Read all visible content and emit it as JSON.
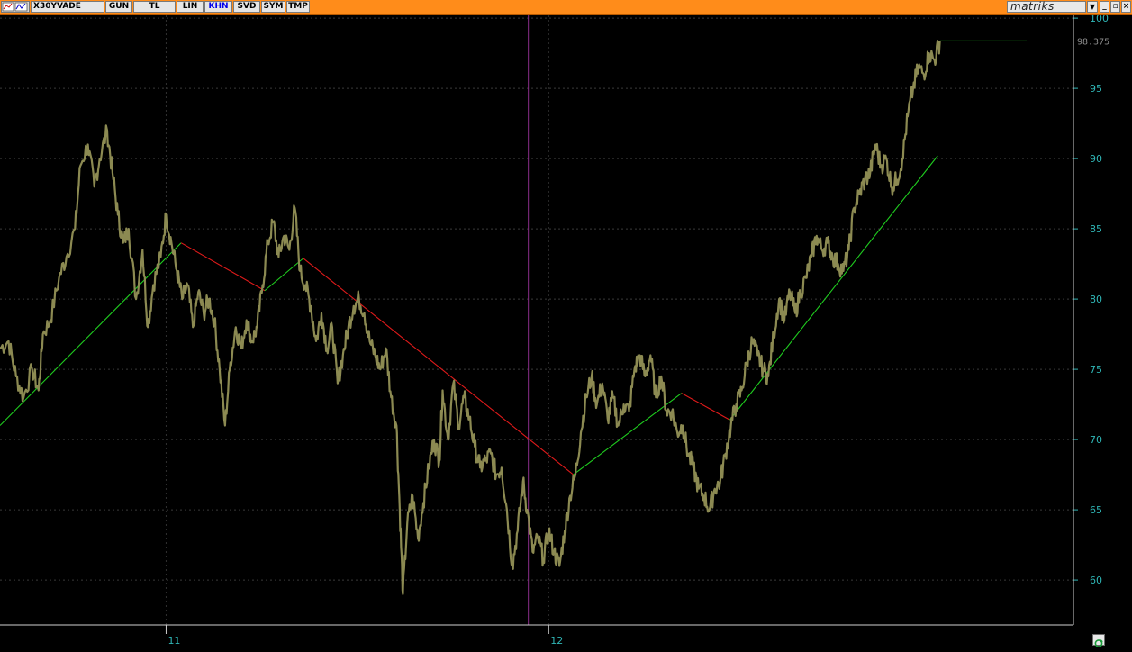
{
  "toolbar": {
    "symbol": "X30YVADE",
    "buttons": [
      "GUN",
      "TL",
      "LIN",
      "KHN",
      "SVD",
      "SYM",
      "TMP"
    ],
    "active_button": "KHN",
    "brand": "matriks",
    "window_controls": [
      "_",
      "restore",
      "x"
    ]
  },
  "colors": {
    "toolbar": "#ff8c1a",
    "price_series": "#8c8a52",
    "uptrend": "#1fcc1f",
    "downtrend": "#e01a1a",
    "axis_text": "#2fb5b5",
    "cursor_line": "#8a2e8a",
    "background": "#000000"
  },
  "chart_data": {
    "type": "line",
    "symbol": "X30YVADE",
    "y_ticks": [
      60,
      65,
      70,
      75,
      80,
      85,
      90,
      95,
      100
    ],
    "ylim": [
      56.8,
      100.2
    ],
    "last_price_label": "98.375",
    "last_price": 98.375,
    "x_tick_labels": [
      {
        "label": "11",
        "t": 0.155
      },
      {
        "label": "12",
        "t": 0.512
      }
    ],
    "cursor_t": 0.493,
    "price_series": [
      [
        0.0,
        76.5
      ],
      [
        0.008,
        77.0
      ],
      [
        0.015,
        74.5
      ],
      [
        0.022,
        73.0
      ],
      [
        0.03,
        75.0
      ],
      [
        0.036,
        73.5
      ],
      [
        0.04,
        77.5
      ],
      [
        0.047,
        78.5
      ],
      [
        0.055,
        81.5
      ],
      [
        0.062,
        83.0
      ],
      [
        0.07,
        85.0
      ],
      [
        0.075,
        89.5
      ],
      [
        0.082,
        91.0
      ],
      [
        0.088,
        88.0
      ],
      [
        0.093,
        90.0
      ],
      [
        0.1,
        92.0
      ],
      [
        0.105,
        89.0
      ],
      [
        0.11,
        86.0
      ],
      [
        0.115,
        84.0
      ],
      [
        0.12,
        85.0
      ],
      [
        0.127,
        80.0
      ],
      [
        0.133,
        83.5
      ],
      [
        0.138,
        78.0
      ],
      [
        0.143,
        81.0
      ],
      [
        0.15,
        83.0
      ],
      [
        0.155,
        86.0
      ],
      [
        0.16,
        84.0
      ],
      [
        0.165,
        82.0
      ],
      [
        0.17,
        80.0
      ],
      [
        0.175,
        81.0
      ],
      [
        0.18,
        78.0
      ],
      [
        0.185,
        80.5
      ],
      [
        0.19,
        79.0
      ],
      [
        0.195,
        80.0
      ],
      [
        0.2,
        78.5
      ],
      [
        0.205,
        75.0
      ],
      [
        0.21,
        71.0
      ],
      [
        0.215,
        75.5
      ],
      [
        0.22,
        78.0
      ],
      [
        0.225,
        76.5
      ],
      [
        0.23,
        78.5
      ],
      [
        0.235,
        77.0
      ],
      [
        0.24,
        78.0
      ],
      [
        0.245,
        81.0
      ],
      [
        0.25,
        84.0
      ],
      [
        0.255,
        85.5
      ],
      [
        0.26,
        83.0
      ],
      [
        0.265,
        84.5
      ],
      [
        0.27,
        83.5
      ],
      [
        0.275,
        86.5
      ],
      [
        0.28,
        82.0
      ],
      [
        0.285,
        81.0
      ],
      [
        0.29,
        79.5
      ],
      [
        0.295,
        77.0
      ],
      [
        0.3,
        79.0
      ],
      [
        0.305,
        76.5
      ],
      [
        0.31,
        78.0
      ],
      [
        0.315,
        74.0
      ],
      [
        0.32,
        76.0
      ],
      [
        0.325,
        78.0
      ],
      [
        0.33,
        79.5
      ],
      [
        0.335,
        80.0
      ],
      [
        0.34,
        79.0
      ],
      [
        0.345,
        77.0
      ],
      [
        0.35,
        76.0
      ],
      [
        0.355,
        75.0
      ],
      [
        0.36,
        76.5
      ],
      [
        0.365,
        73.0
      ],
      [
        0.37,
        71.0
      ],
      [
        0.373,
        65.0
      ],
      [
        0.376,
        59.0
      ],
      [
        0.38,
        64.0
      ],
      [
        0.385,
        66.0
      ],
      [
        0.39,
        63.0
      ],
      [
        0.395,
        65.5
      ],
      [
        0.4,
        68.0
      ],
      [
        0.405,
        70.0
      ],
      [
        0.41,
        68.5
      ],
      [
        0.413,
        73.5
      ],
      [
        0.418,
        70.0
      ],
      [
        0.423,
        74.0
      ],
      [
        0.428,
        71.0
      ],
      [
        0.433,
        73.0
      ],
      [
        0.438,
        71.5
      ],
      [
        0.443,
        69.5
      ],
      [
        0.448,
        68.0
      ],
      [
        0.453,
        68.5
      ],
      [
        0.458,
        69.0
      ],
      [
        0.463,
        67.5
      ],
      [
        0.468,
        68.0
      ],
      [
        0.473,
        65.0
      ],
      [
        0.478,
        61.0
      ],
      [
        0.483,
        63.5
      ],
      [
        0.488,
        67.0
      ],
      [
        0.492,
        65.0
      ],
      [
        0.497,
        62.0
      ],
      [
        0.502,
        63.0
      ],
      [
        0.507,
        61.5
      ],
      [
        0.512,
        63.5
      ],
      [
        0.517,
        62.0
      ],
      [
        0.522,
        61.0
      ],
      [
        0.527,
        63.5
      ],
      [
        0.532,
        66.0
      ],
      [
        0.537,
        67.5
      ],
      [
        0.542,
        70.5
      ],
      [
        0.547,
        73.0
      ],
      [
        0.552,
        74.5
      ],
      [
        0.557,
        72.5
      ],
      [
        0.562,
        74.0
      ],
      [
        0.567,
        71.5
      ],
      [
        0.572,
        73.0
      ],
      [
        0.577,
        71.0
      ],
      [
        0.582,
        72.5
      ],
      [
        0.587,
        72.0
      ],
      [
        0.592,
        75.0
      ],
      [
        0.597,
        76.0
      ],
      [
        0.602,
        74.5
      ],
      [
        0.607,
        76.0
      ],
      [
        0.612,
        73.0
      ],
      [
        0.617,
        74.5
      ],
      [
        0.622,
        72.0
      ],
      [
        0.627,
        72.0
      ],
      [
        0.632,
        70.5
      ],
      [
        0.637,
        71.0
      ],
      [
        0.642,
        69.0
      ],
      [
        0.647,
        68.0
      ],
      [
        0.652,
        66.5
      ],
      [
        0.657,
        66.0
      ],
      [
        0.662,
        65.0
      ],
      [
        0.667,
        66.5
      ],
      [
        0.672,
        67.0
      ],
      [
        0.677,
        69.0
      ],
      [
        0.682,
        71.0
      ],
      [
        0.687,
        72.5
      ],
      [
        0.692,
        73.5
      ],
      [
        0.697,
        75.5
      ],
      [
        0.702,
        77.0
      ],
      [
        0.707,
        76.0
      ],
      [
        0.712,
        75.0
      ],
      [
        0.717,
        74.5
      ],
      [
        0.722,
        77.5
      ],
      [
        0.727,
        80.0
      ],
      [
        0.732,
        78.5
      ],
      [
        0.737,
        80.5
      ],
      [
        0.742,
        79.0
      ],
      [
        0.747,
        80.5
      ],
      [
        0.752,
        81.5
      ],
      [
        0.757,
        83.0
      ],
      [
        0.762,
        84.5
      ],
      [
        0.767,
        83.5
      ],
      [
        0.772,
        84.0
      ],
      [
        0.777,
        83.0
      ],
      [
        0.782,
        82.5
      ],
      [
        0.787,
        82.0
      ],
      [
        0.792,
        83.5
      ],
      [
        0.797,
        86.5
      ],
      [
        0.802,
        87.5
      ],
      [
        0.807,
        88.5
      ],
      [
        0.812,
        89.0
      ],
      [
        0.817,
        91.0
      ],
      [
        0.822,
        89.5
      ],
      [
        0.827,
        90.0
      ],
      [
        0.832,
        88.0
      ],
      [
        0.837,
        88.5
      ],
      [
        0.842,
        90.0
      ],
      [
        0.847,
        93.0
      ],
      [
        0.852,
        95.0
      ],
      [
        0.857,
        96.5
      ],
      [
        0.862,
        96.0
      ],
      [
        0.867,
        97.5
      ],
      [
        0.872,
        97.0
      ],
      [
        0.877,
        98.375
      ]
    ],
    "trend_lines": [
      {
        "color": "uptrend",
        "points": [
          [
            0.0,
            71.0
          ],
          [
            0.169,
            84.0
          ]
        ]
      },
      {
        "color": "downtrend",
        "points": [
          [
            0.169,
            84.0
          ],
          [
            0.247,
            80.6
          ]
        ]
      },
      {
        "color": "uptrend",
        "points": [
          [
            0.247,
            80.6
          ],
          [
            0.283,
            82.9
          ]
        ]
      },
      {
        "color": "downtrend",
        "points": [
          [
            0.283,
            82.9
          ],
          [
            0.535,
            67.5
          ]
        ]
      },
      {
        "color": "uptrend",
        "points": [
          [
            0.535,
            67.5
          ],
          [
            0.636,
            73.3
          ]
        ]
      },
      {
        "color": "downtrend",
        "points": [
          [
            0.636,
            73.3
          ],
          [
            0.681,
            71.4
          ]
        ]
      },
      {
        "color": "uptrend",
        "points": [
          [
            0.681,
            71.4
          ],
          [
            0.875,
            90.2
          ]
        ]
      },
      {
        "color": "uptrend",
        "points": [
          [
            0.877,
            98.375
          ],
          [
            0.958,
            98.375
          ]
        ]
      }
    ]
  }
}
